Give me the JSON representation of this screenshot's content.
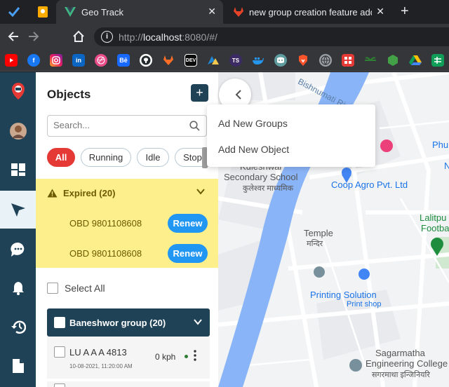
{
  "browser": {
    "tabs": [
      {
        "title": "Geo Track",
        "close": "✕"
      },
      {
        "title": "new group creation feature adde",
        "close": "✕"
      }
    ],
    "new_tab": "+",
    "url_host": "localhost",
    "url_prefix": "http://",
    "url_suffix": ":8080/#/",
    "bookmark_icons": [
      "youtube-icon",
      "facebook-icon",
      "instagram-icon",
      "linkedin-icon",
      "dribbble-icon",
      "behance-icon",
      "github-icon",
      "gitlab-icon",
      "dev-icon",
      "codeberg-icon",
      "typescript-icon",
      "docker-icon",
      "discord-icon",
      "brave-icon",
      "globe-icon",
      "grid-app-icon",
      "sprout-icon",
      "nodejs-icon",
      "drive-icon",
      "sheets-icon"
    ]
  },
  "sidebar": {
    "icons": [
      "logo-icon",
      "avatar",
      "dashboard-icon",
      "navigation-icon",
      "chat-icon",
      "bell-icon",
      "history-icon",
      "document-icon"
    ]
  },
  "panel": {
    "title": "Objects",
    "add_label": "+",
    "search_placeholder": "Search...",
    "filters": [
      "All",
      "Running",
      "Idle",
      "Stop"
    ],
    "expired": {
      "label": "Expired (20)",
      "items": [
        {
          "name": "OBD 9801108608",
          "action": "Renew"
        },
        {
          "name": "OBD 9801108608",
          "action": "Renew"
        }
      ]
    },
    "select_all": "Select All",
    "group": {
      "label": "Baneshwor group (20)",
      "vehicles": [
        {
          "name": "LU A A A 4813",
          "datetime": "10-08-2021, 11:20:00 AM",
          "speed": "0 kph"
        }
      ]
    }
  },
  "dropdown": {
    "items": [
      "Ad New Groups",
      "Add New Object"
    ]
  },
  "map": {
    "labels": {
      "river": "Bishnumati Riv",
      "school_1": "Kuleshwar",
      "school_2": "Secondary School",
      "school_np": "कुलेश्वर माध्यमिक",
      "coop": "Coop Agro Pvt. Ltd",
      "temple": "Temple",
      "temple_np": "मन्दिर",
      "printing": "Printing Solution",
      "printing_sub": "Print shop",
      "college_1": "Sagarmatha",
      "college_2": "Engineering College",
      "college_np": "सगरमाथा इन्जिनियरि",
      "lalitpur": "Lalitpu",
      "football": "Footba",
      "phu": "Phu",
      "edge_n": "N"
    }
  },
  "colors": {
    "primary": "#1f4257",
    "danger": "#e53935",
    "warning_bg": "#fdf08c",
    "accent": "#2196f3"
  }
}
